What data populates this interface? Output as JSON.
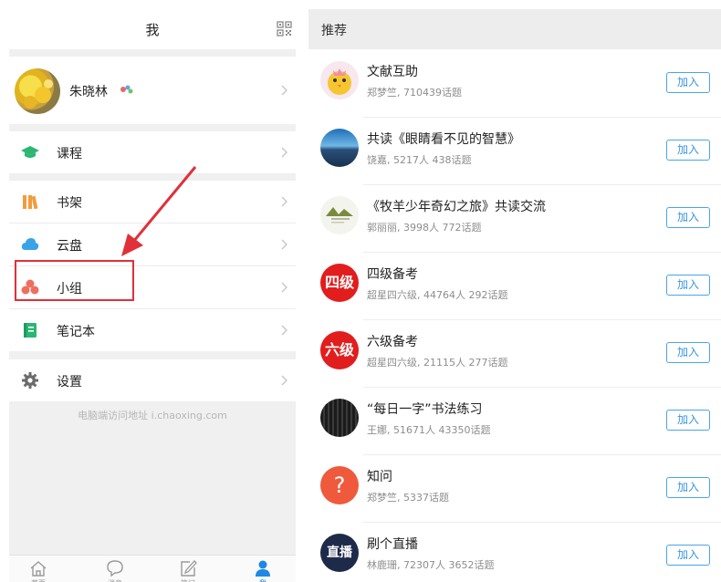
{
  "me_screen": {
    "title": "我",
    "profile": {
      "name": "朱晓林"
    },
    "menu": {
      "course": "课程",
      "bookshelf": "书架",
      "cloud": "云盘",
      "group": "小组",
      "notebook": "笔记本",
      "settings": "设置"
    },
    "footer_url": "电脑端访问地址 i.chaoxing.com",
    "tabs": [
      {
        "label": "首页",
        "icon": "home-icon"
      },
      {
        "label": "消息",
        "icon": "message-icon"
      },
      {
        "label": "笔记",
        "icon": "note-edit-icon"
      },
      {
        "label": "我",
        "icon": "person-icon"
      }
    ],
    "active_tab": "我",
    "highlight_color": "#e0303a",
    "accent_color": "#1e88e5"
  },
  "recommend_screen": {
    "title": "推荐",
    "join_label": "加入",
    "groups": [
      {
        "name": "文献互助",
        "meta": "郑梦竺, 710439话题",
        "avatar": "chick-avatar"
      },
      {
        "name": "共读《眼睛看不见的智慧》",
        "meta": "饶嘉, 5217人 438话题",
        "avatar": "landscape-avatar"
      },
      {
        "name": "《牧羊少年奇幻之旅》共读交流",
        "meta": "郭丽丽, 3998人 772话题",
        "avatar": "book-cover-avatar"
      },
      {
        "name": "四级备考",
        "meta": "超星四六级, 44764人 292话题",
        "avatar": "cet4-avatar",
        "badge": "四级"
      },
      {
        "name": "六级备考",
        "meta": "超星四六级, 21115人 277话题",
        "avatar": "cet6-avatar",
        "badge": "六级"
      },
      {
        "name": "“每日一字”书法练习",
        "meta": "王娜, 51671人 43350话题",
        "avatar": "calligraphy-avatar"
      },
      {
        "name": "知问",
        "meta": "郑梦竺, 5337话题",
        "avatar": "question-avatar",
        "badge": "?"
      },
      {
        "name": "刷个直播",
        "meta": "林鹿珊, 72307人 3652话题",
        "avatar": "live-avatar",
        "badge": "直播"
      }
    ]
  }
}
